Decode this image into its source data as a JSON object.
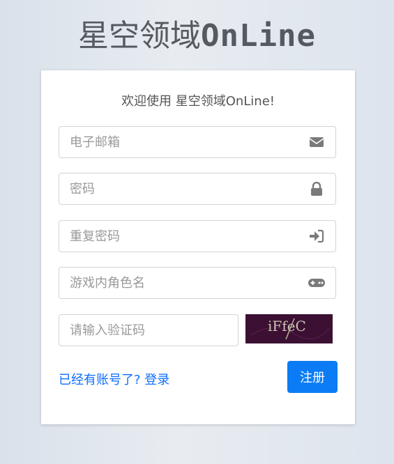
{
  "header": {
    "title_cn": "星空领域",
    "title_en": "OnLine"
  },
  "form": {
    "welcome": "欢迎使用 星空领域OnLine!",
    "email_placeholder": "电子邮箱",
    "password_placeholder": "密码",
    "repeat_password_placeholder": "重复密码",
    "nickname_placeholder": "游戏内角色名",
    "captcha_placeholder": "请输入验证码",
    "captcha_text": "iFfeC",
    "login_link": "已经有账号了? 登录",
    "register_button": "注册"
  },
  "colors": {
    "accent": "#0b7cf5",
    "link": "#0d6efd",
    "captcha_bg": "#3b1033"
  },
  "icons": {
    "email": "envelope-icon",
    "password": "lock-icon",
    "repeat_password": "sign-in-icon",
    "nickname": "gamepad-icon"
  }
}
